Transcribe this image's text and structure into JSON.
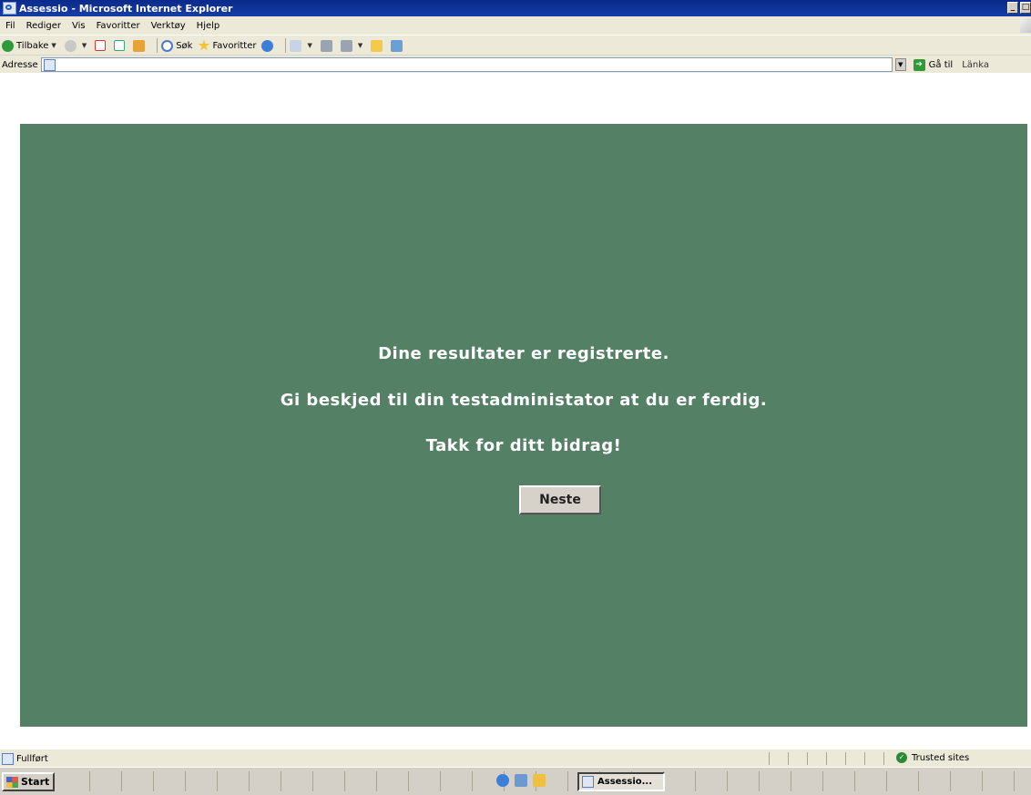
{
  "window": {
    "title": "Assessio - Microsoft Internet Explorer"
  },
  "menu": [
    "Fil",
    "Rediger",
    "Vis",
    "Favoritter",
    "Verktøy",
    "Hjelp"
  ],
  "toolbar": {
    "back_label": "Tilbake",
    "search_label": "Søk",
    "favorites_label": "Favoritter"
  },
  "address": {
    "label": "Adresse",
    "value": "",
    "go_label": "Gå til",
    "links_label": "Länka"
  },
  "content": {
    "line1": "Dine resultater er registrerte.",
    "line2": "Gi beskjed til din testadministator at du er ferdig.",
    "line3": "Takk for ditt bidrag!",
    "next_button": "Neste",
    "panel_color": "#548065"
  },
  "status": {
    "text": "Fullført",
    "zone": "Trusted sites"
  },
  "taskbar": {
    "start_label": "Start",
    "task_label": "Assessio..."
  }
}
